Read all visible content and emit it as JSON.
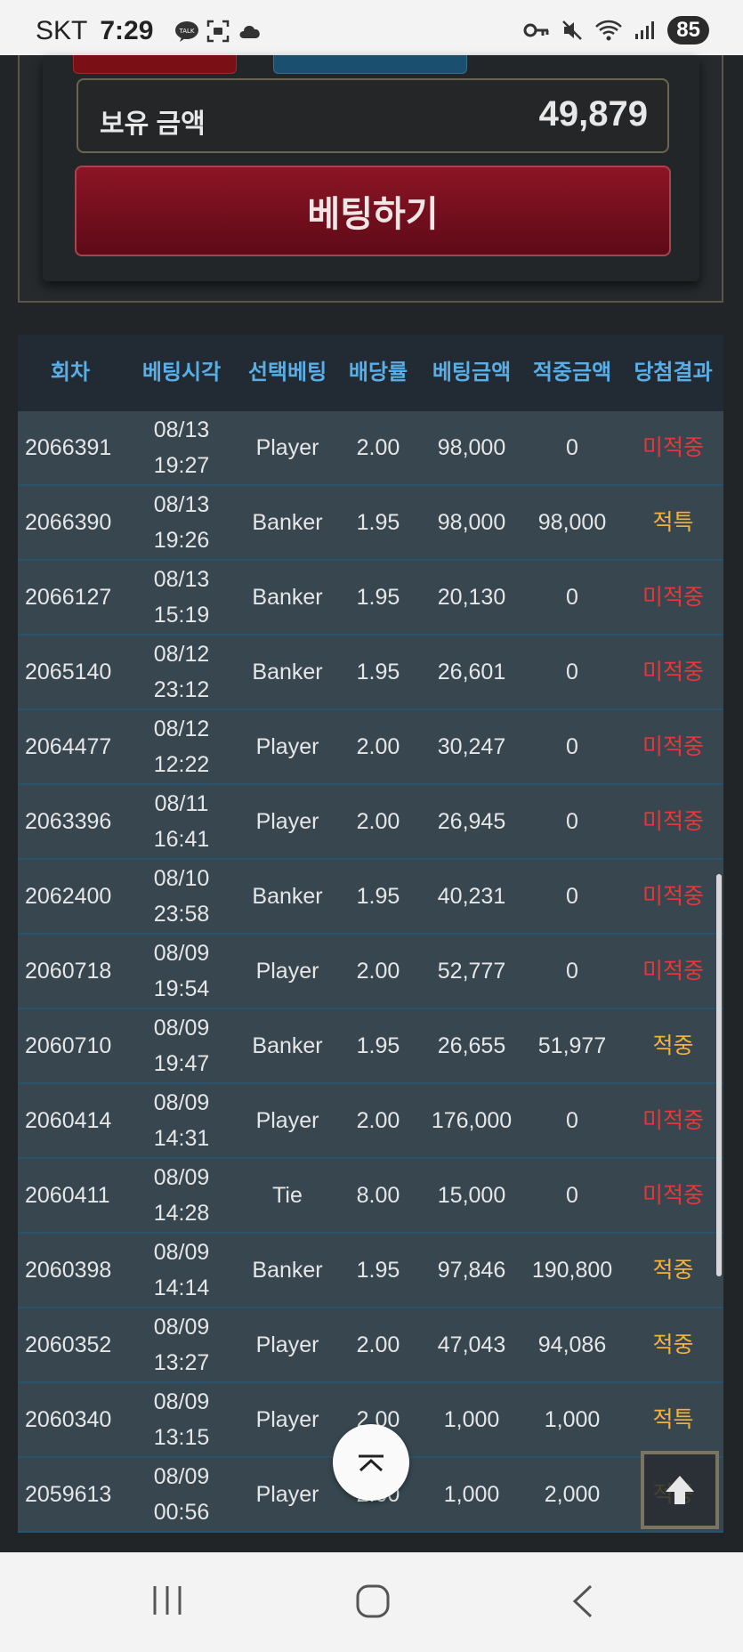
{
  "status_bar": {
    "carrier": "SKT",
    "time": "7:29",
    "battery": "85",
    "left_icons": [
      "kakaotalk-icon",
      "screenshot-icon",
      "cloud-icon"
    ],
    "right_icons": [
      "vpn-key-icon",
      "mute-icon",
      "wifi-icon",
      "signal-icon"
    ]
  },
  "bet_panel": {
    "balance_label": "보유 금액",
    "balance_value": "49,879",
    "bet_button_label": "베팅하기"
  },
  "table": {
    "headers": [
      "회차",
      "베팅시각",
      "선택베팅",
      "배당률",
      "베팅금액",
      "적중금액",
      "당첨결과"
    ],
    "rows": [
      {
        "round": "2066391",
        "date": "08/13",
        "time": "19:27",
        "pick": "Player",
        "odds": "2.00",
        "bet": "98,000",
        "win": "0",
        "result": "미적중",
        "status": "lose"
      },
      {
        "round": "2066390",
        "date": "08/13",
        "time": "19:26",
        "pick": "Banker",
        "odds": "1.95",
        "bet": "98,000",
        "win": "98,000",
        "result": "적특",
        "status": "special"
      },
      {
        "round": "2066127",
        "date": "08/13",
        "time": "15:19",
        "pick": "Banker",
        "odds": "1.95",
        "bet": "20,130",
        "win": "0",
        "result": "미적중",
        "status": "lose"
      },
      {
        "round": "2065140",
        "date": "08/12",
        "time": "23:12",
        "pick": "Banker",
        "odds": "1.95",
        "bet": "26,601",
        "win": "0",
        "result": "미적중",
        "status": "lose"
      },
      {
        "round": "2064477",
        "date": "08/12",
        "time": "12:22",
        "pick": "Player",
        "odds": "2.00",
        "bet": "30,247",
        "win": "0",
        "result": "미적중",
        "status": "lose"
      },
      {
        "round": "2063396",
        "date": "08/11",
        "time": "16:41",
        "pick": "Player",
        "odds": "2.00",
        "bet": "26,945",
        "win": "0",
        "result": "미적중",
        "status": "lose"
      },
      {
        "round": "2062400",
        "date": "08/10",
        "time": "23:58",
        "pick": "Banker",
        "odds": "1.95",
        "bet": "40,231",
        "win": "0",
        "result": "미적중",
        "status": "lose"
      },
      {
        "round": "2060718",
        "date": "08/09",
        "time": "19:54",
        "pick": "Player",
        "odds": "2.00",
        "bet": "52,777",
        "win": "0",
        "result": "미적중",
        "status": "lose"
      },
      {
        "round": "2060710",
        "date": "08/09",
        "time": "19:47",
        "pick": "Banker",
        "odds": "1.95",
        "bet": "26,655",
        "win": "51,977",
        "result": "적중",
        "status": "win"
      },
      {
        "round": "2060414",
        "date": "08/09",
        "time": "14:31",
        "pick": "Player",
        "odds": "2.00",
        "bet": "176,000",
        "win": "0",
        "result": "미적중",
        "status": "lose"
      },
      {
        "round": "2060411",
        "date": "08/09",
        "time": "14:28",
        "pick": "Tie",
        "odds": "8.00",
        "bet": "15,000",
        "win": "0",
        "result": "미적중",
        "status": "lose"
      },
      {
        "round": "2060398",
        "date": "08/09",
        "time": "14:14",
        "pick": "Banker",
        "odds": "1.95",
        "bet": "97,846",
        "win": "190,800",
        "result": "적중",
        "status": "win"
      },
      {
        "round": "2060352",
        "date": "08/09",
        "time": "13:27",
        "pick": "Player",
        "odds": "2.00",
        "bet": "47,043",
        "win": "94,086",
        "result": "적중",
        "status": "win"
      },
      {
        "round": "2060340",
        "date": "08/09",
        "time": "13:15",
        "pick": "Player",
        "odds": "2.00",
        "bet": "1,000",
        "win": "1,000",
        "result": "적특",
        "status": "special"
      },
      {
        "round": "2059613",
        "date": "08/09",
        "time": "00:56",
        "pick": "Player",
        "odds": "2.00",
        "bet": "1,000",
        "win": "2,000",
        "result": "적중",
        "status": "win"
      }
    ]
  },
  "colors": {
    "lose": "#e6373c",
    "win": "#f2b33a",
    "header_text": "#5aaee6",
    "bet_button": "#8c1524"
  },
  "floating": {
    "scroll_top_circle_icon": "chevron-up-icon",
    "scroll_top_square_icon": "arrow-up-icon"
  },
  "nav_bar": {
    "icons": [
      "recent-apps-icon",
      "home-icon",
      "back-icon"
    ]
  }
}
